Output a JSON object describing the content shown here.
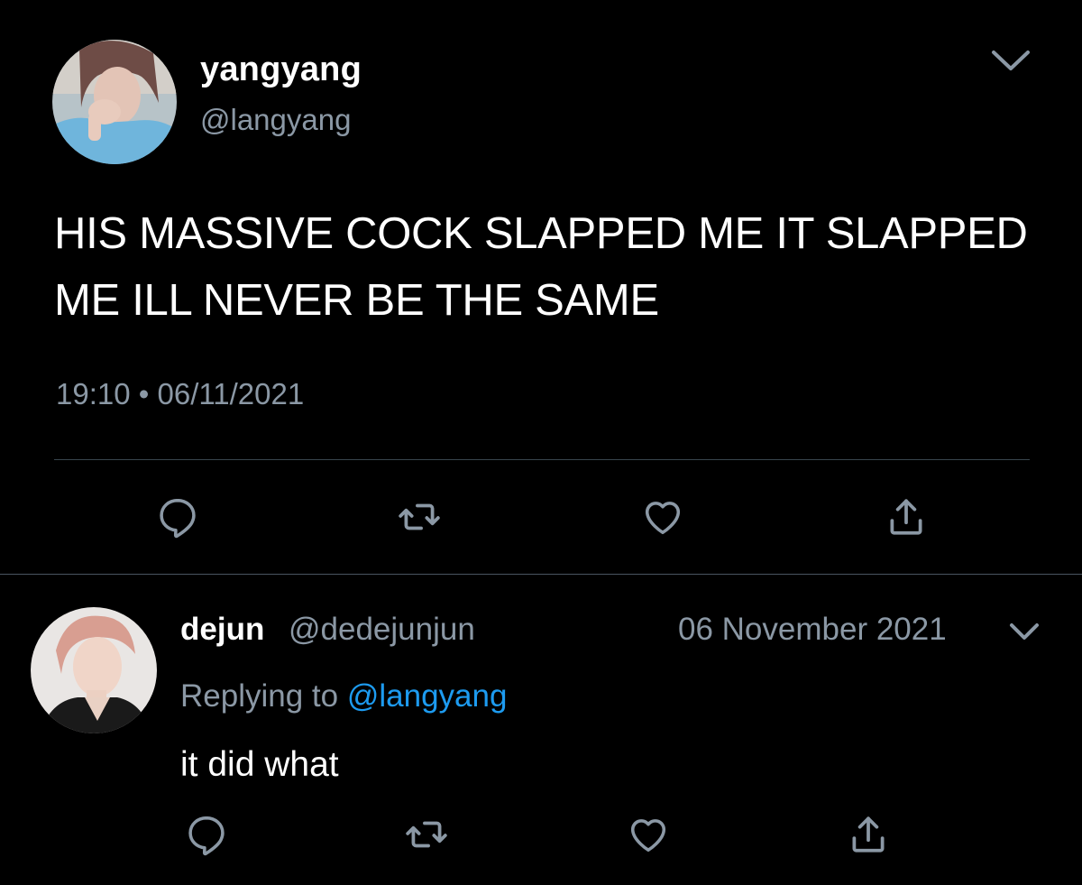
{
  "main_tweet": {
    "author_name": "yangyang",
    "handle": "@langyang",
    "text": "HIS MASSIVE COCK SLAPPED ME IT SLAPPED ME ILL NEVER BE THE SAME",
    "time": "19:10",
    "separator": "•",
    "date": "06/11/2021",
    "menu_icon": "chevron-down-icon",
    "actions": [
      {
        "name": "reply",
        "icon": "reply-icon"
      },
      {
        "name": "retweet",
        "icon": "retweet-icon"
      },
      {
        "name": "like",
        "icon": "heart-icon"
      },
      {
        "name": "share",
        "icon": "share-icon"
      }
    ]
  },
  "reply_tweet": {
    "author_name": "dejun",
    "handle": "@dedejunjun",
    "date": "06 November 2021",
    "replying_prefix": "Replying to",
    "replying_to": "@langyang",
    "text": "it did what",
    "menu_icon": "chevron-down-icon",
    "actions": [
      {
        "name": "reply",
        "icon": "reply-icon"
      },
      {
        "name": "retweet",
        "icon": "retweet-icon"
      },
      {
        "name": "like",
        "icon": "heart-icon"
      },
      {
        "name": "share",
        "icon": "share-icon"
      }
    ]
  },
  "colors": {
    "background": "#000000",
    "primary_text": "#ffffff",
    "secondary_text": "#8b98a5",
    "link": "#1d9bf0",
    "divider": "#38444d"
  }
}
